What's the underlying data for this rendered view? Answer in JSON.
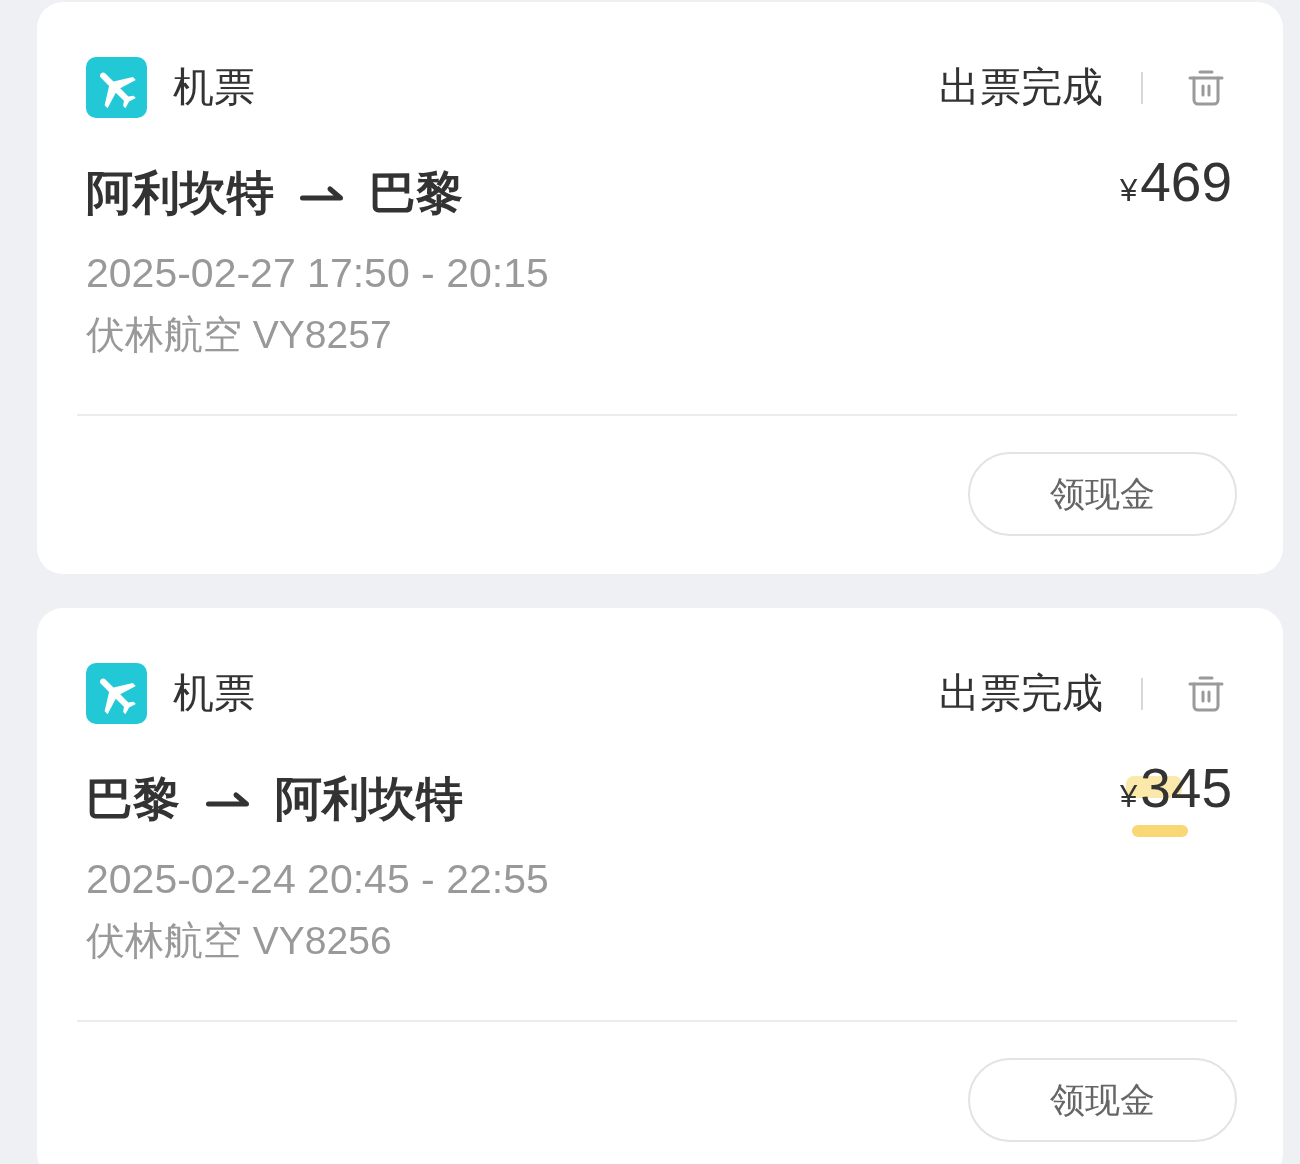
{
  "orders": [
    {
      "category": "机票",
      "status": "出票完成",
      "origin": "阿利坎特",
      "destination": "巴黎",
      "currency": "¥",
      "amount": "469",
      "time": "2025-02-27 17:50 - 20:15",
      "flight": "伏林航空 VY8257",
      "action": "领现金",
      "highlighted": false
    },
    {
      "category": "机票",
      "status": "出票完成",
      "origin": "巴黎",
      "destination": "阿利坎特",
      "currency": "¥",
      "amount": "345",
      "time": "2025-02-24 20:45 - 22:55",
      "flight": "伏林航空 VY8256",
      "action": "领现金",
      "highlighted": true
    }
  ]
}
